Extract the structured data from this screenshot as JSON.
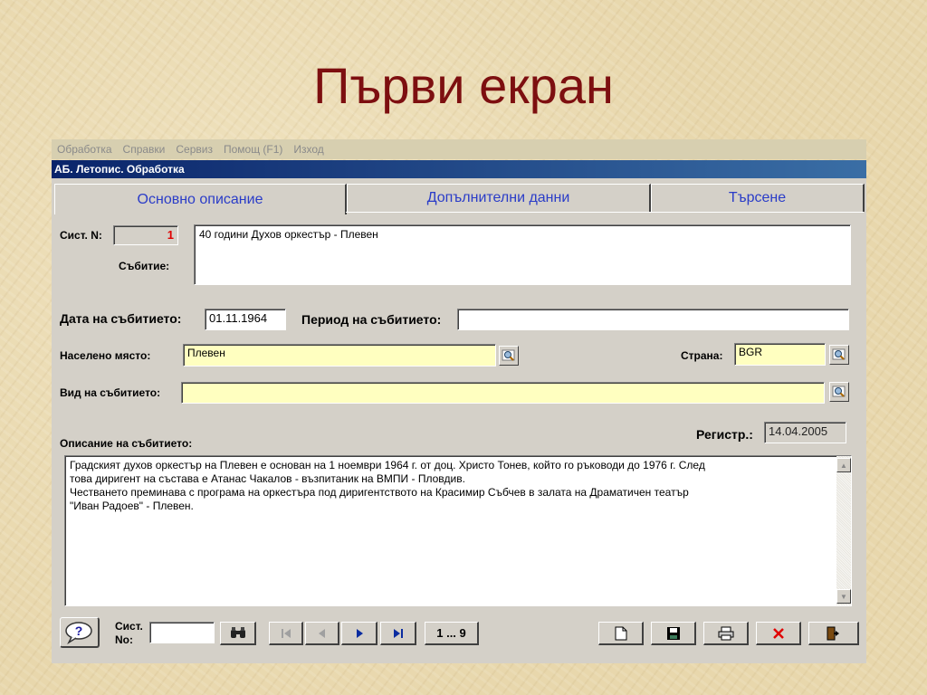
{
  "slide": {
    "title": "Първи екран"
  },
  "menu": {
    "items": [
      "Обработка",
      "Справки",
      "Сервиз",
      "Помощ (F1)",
      "Изход"
    ]
  },
  "window": {
    "title": "АБ. Летопис. Обработка"
  },
  "tabs": [
    {
      "label": "Основно описание",
      "active": true
    },
    {
      "label": "Допълнителни данни",
      "active": false
    },
    {
      "label": "Търсене",
      "active": false
    }
  ],
  "form": {
    "sys_n_label": "Сист. N:",
    "sys_n_value": "1",
    "event_label": "Събитие:",
    "event_value": "40 години Духов оркестър - Плевен",
    "date_label": "Дата на събитието:",
    "date_value": "01.11.1964",
    "period_label": "Период на събитието:",
    "period_value": "",
    "place_label": "Населено място:",
    "place_value": "Плевен",
    "country_label": "Страна:",
    "country_value": "BGR",
    "type_label": "Вид на събитието:",
    "type_value": "",
    "registered_label": "Регистр.:",
    "registered_value": "14.04.2005",
    "description_label": "Описание на събитието:",
    "description_lines": [
      "Градският духов оркестър на Плевен е основан на 1 ноември 1964 г. от доц. Христо Тонев, който го ръководи до 1976 г. След",
      "това диригент на състава е Атанас Чакалов - възпитаник на ВМПИ - Пловдив.",
      "Честването преминава с програма на оркестъра под диригентството на Красимир Събчев в залата на Драматичен театър",
      "\"Иван Радоев\" - Плевен."
    ]
  },
  "toolbar": {
    "help_glyph": "?",
    "sys_no_label_1": "Сист.",
    "sys_no_label_2": "No:",
    "sys_no_value": "",
    "range_label": "1 ... 9"
  },
  "colors": {
    "slide_title": "#7d0f10",
    "tab_text": "#2a3cc8",
    "sys_n_value": "#e00000",
    "field_yellow": "#ffffc0",
    "delete_red": "#e00000",
    "nav_blue": "#0a2ca0"
  },
  "icons": [
    "help-icon",
    "binoculars-icon",
    "first-record-icon",
    "prev-record-icon",
    "next-record-icon",
    "last-record-icon",
    "new-document-icon",
    "save-disk-icon",
    "print-icon",
    "delete-x-icon",
    "exit-door-icon",
    "lookup-search-icon"
  ]
}
